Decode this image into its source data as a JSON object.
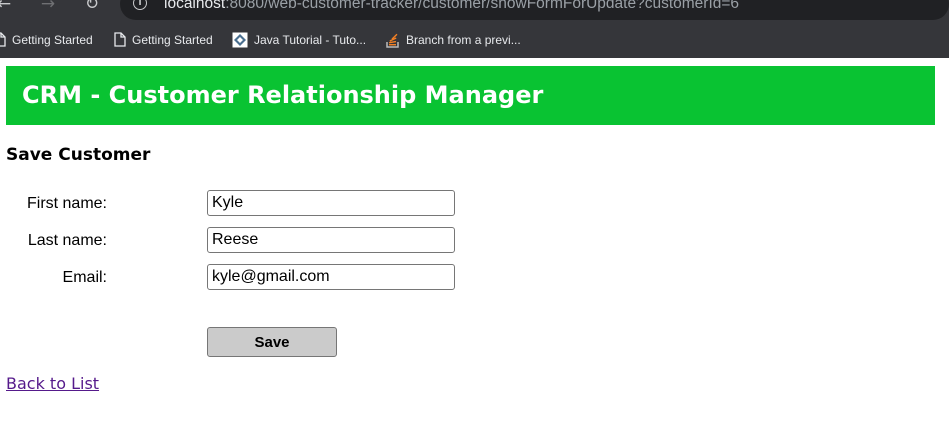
{
  "browser": {
    "url_host": "localhost",
    "url_path": ":8080/web-customer-tracker/customer/showFormForUpdate?customerId=6",
    "nav": {
      "back": "←",
      "forward": "→",
      "reload": "↻",
      "info": "i"
    },
    "bookmarks": [
      {
        "label": "Getting Started",
        "icon": "page-icon"
      },
      {
        "label": "Getting Started",
        "icon": "page-icon"
      },
      {
        "label": "Java Tutorial - Tuto...",
        "icon": "java-tutorial-icon"
      },
      {
        "label": "Branch from a previ...",
        "icon": "stackoverflow-icon"
      }
    ]
  },
  "header": {
    "title": "CRM - Customer Relationship Manager",
    "color": "#09c332"
  },
  "form": {
    "heading": "Save Customer",
    "fields": [
      {
        "label": "First name:",
        "value": "Kyle"
      },
      {
        "label": "Last name:",
        "value": "Reese"
      },
      {
        "label": "Email:",
        "value": "kyle@gmail.com"
      }
    ],
    "save_label": "Save"
  },
  "back_link": "Back to List"
}
